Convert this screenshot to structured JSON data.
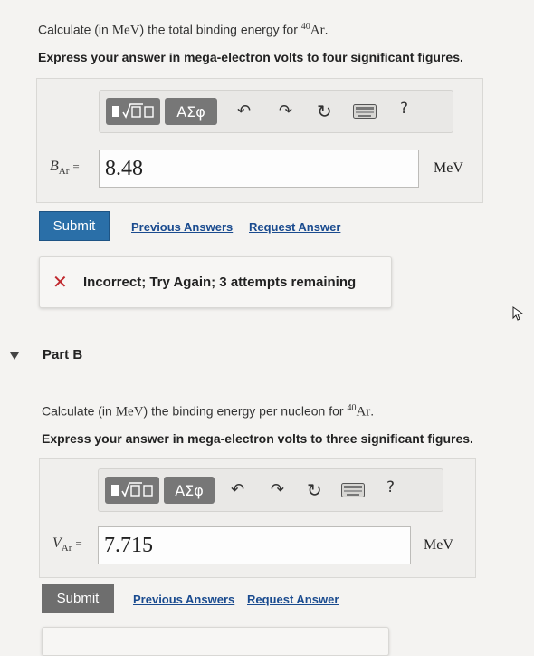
{
  "part_a": {
    "question_prefix": "Calculate (in ",
    "unit_mev": "MeV",
    "question_mid": ") the total binding energy for ",
    "isotope_mass": "40",
    "isotope_symbol": "Ar",
    "question_suffix": ".",
    "instruction": "Express your answer in mega-electron volts to four significant figures.",
    "var_main": "B",
    "var_sub": "Ar",
    "equals": "=",
    "answer_value": "8.48",
    "answer_unit": "MeV",
    "submit_label": "Submit",
    "previous_answers_label": "Previous Answers",
    "request_answer_label": "Request Answer",
    "feedback_icon": "✕",
    "feedback_text": "Incorrect; Try Again; 3 attempts remaining"
  },
  "part_b": {
    "header": "Part B",
    "question_prefix": "Calculate (in ",
    "unit_mev": "MeV",
    "question_mid": ") the binding energy per nucleon for ",
    "isotope_mass": "40",
    "isotope_symbol": "Ar",
    "question_suffix": ".",
    "instruction": "Express your answer in mega-electron volts to three significant figures.",
    "var_main": "V",
    "var_sub": "Ar",
    "equals": "=",
    "answer_value": "7.715",
    "answer_unit": "MeV",
    "submit_label": "Submit",
    "previous_answers_label": "Previous Answers",
    "request_answer_label": "Request Answer"
  },
  "toolbar": {
    "greek_label": "ΑΣφ",
    "help_label": "?",
    "icons": [
      "templates-icon",
      "greek-symbols-icon",
      "undo-icon",
      "redo-icon",
      "reset-icon",
      "keyboard-icon",
      "help-icon"
    ]
  },
  "colors": {
    "submit_a": "#2a6fa8",
    "submit_b": "#6e6e6e",
    "link": "#1a4b8f",
    "error_x": "#c0282d"
  }
}
